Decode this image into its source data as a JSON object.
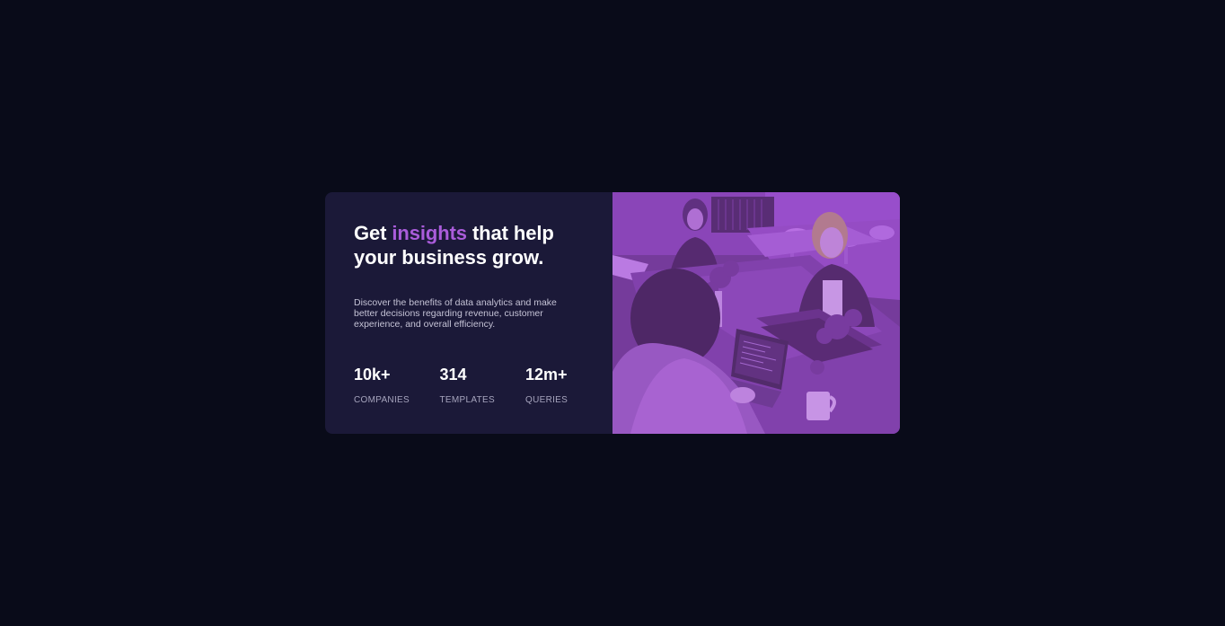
{
  "card": {
    "headline": {
      "before": "Get ",
      "accent": "insights",
      "after": " that help your business grow."
    },
    "description": "Discover the benefits of data analytics and make better decisions regarding revenue, customer experience, and overall efficiency.",
    "stats": [
      {
        "value": "10k+",
        "label": "COMPANIES"
      },
      {
        "value": "314",
        "label": "TEMPLATES"
      },
      {
        "value": "12m+",
        "label": "QUERIES"
      }
    ],
    "image": {
      "description": "Women working at a table with a laptop, purple tint",
      "tint_color": "#aa5cdb"
    }
  },
  "colors": {
    "page_background": "#090b19",
    "card_background": "#1b1938",
    "accent": "#aa5cdb"
  }
}
